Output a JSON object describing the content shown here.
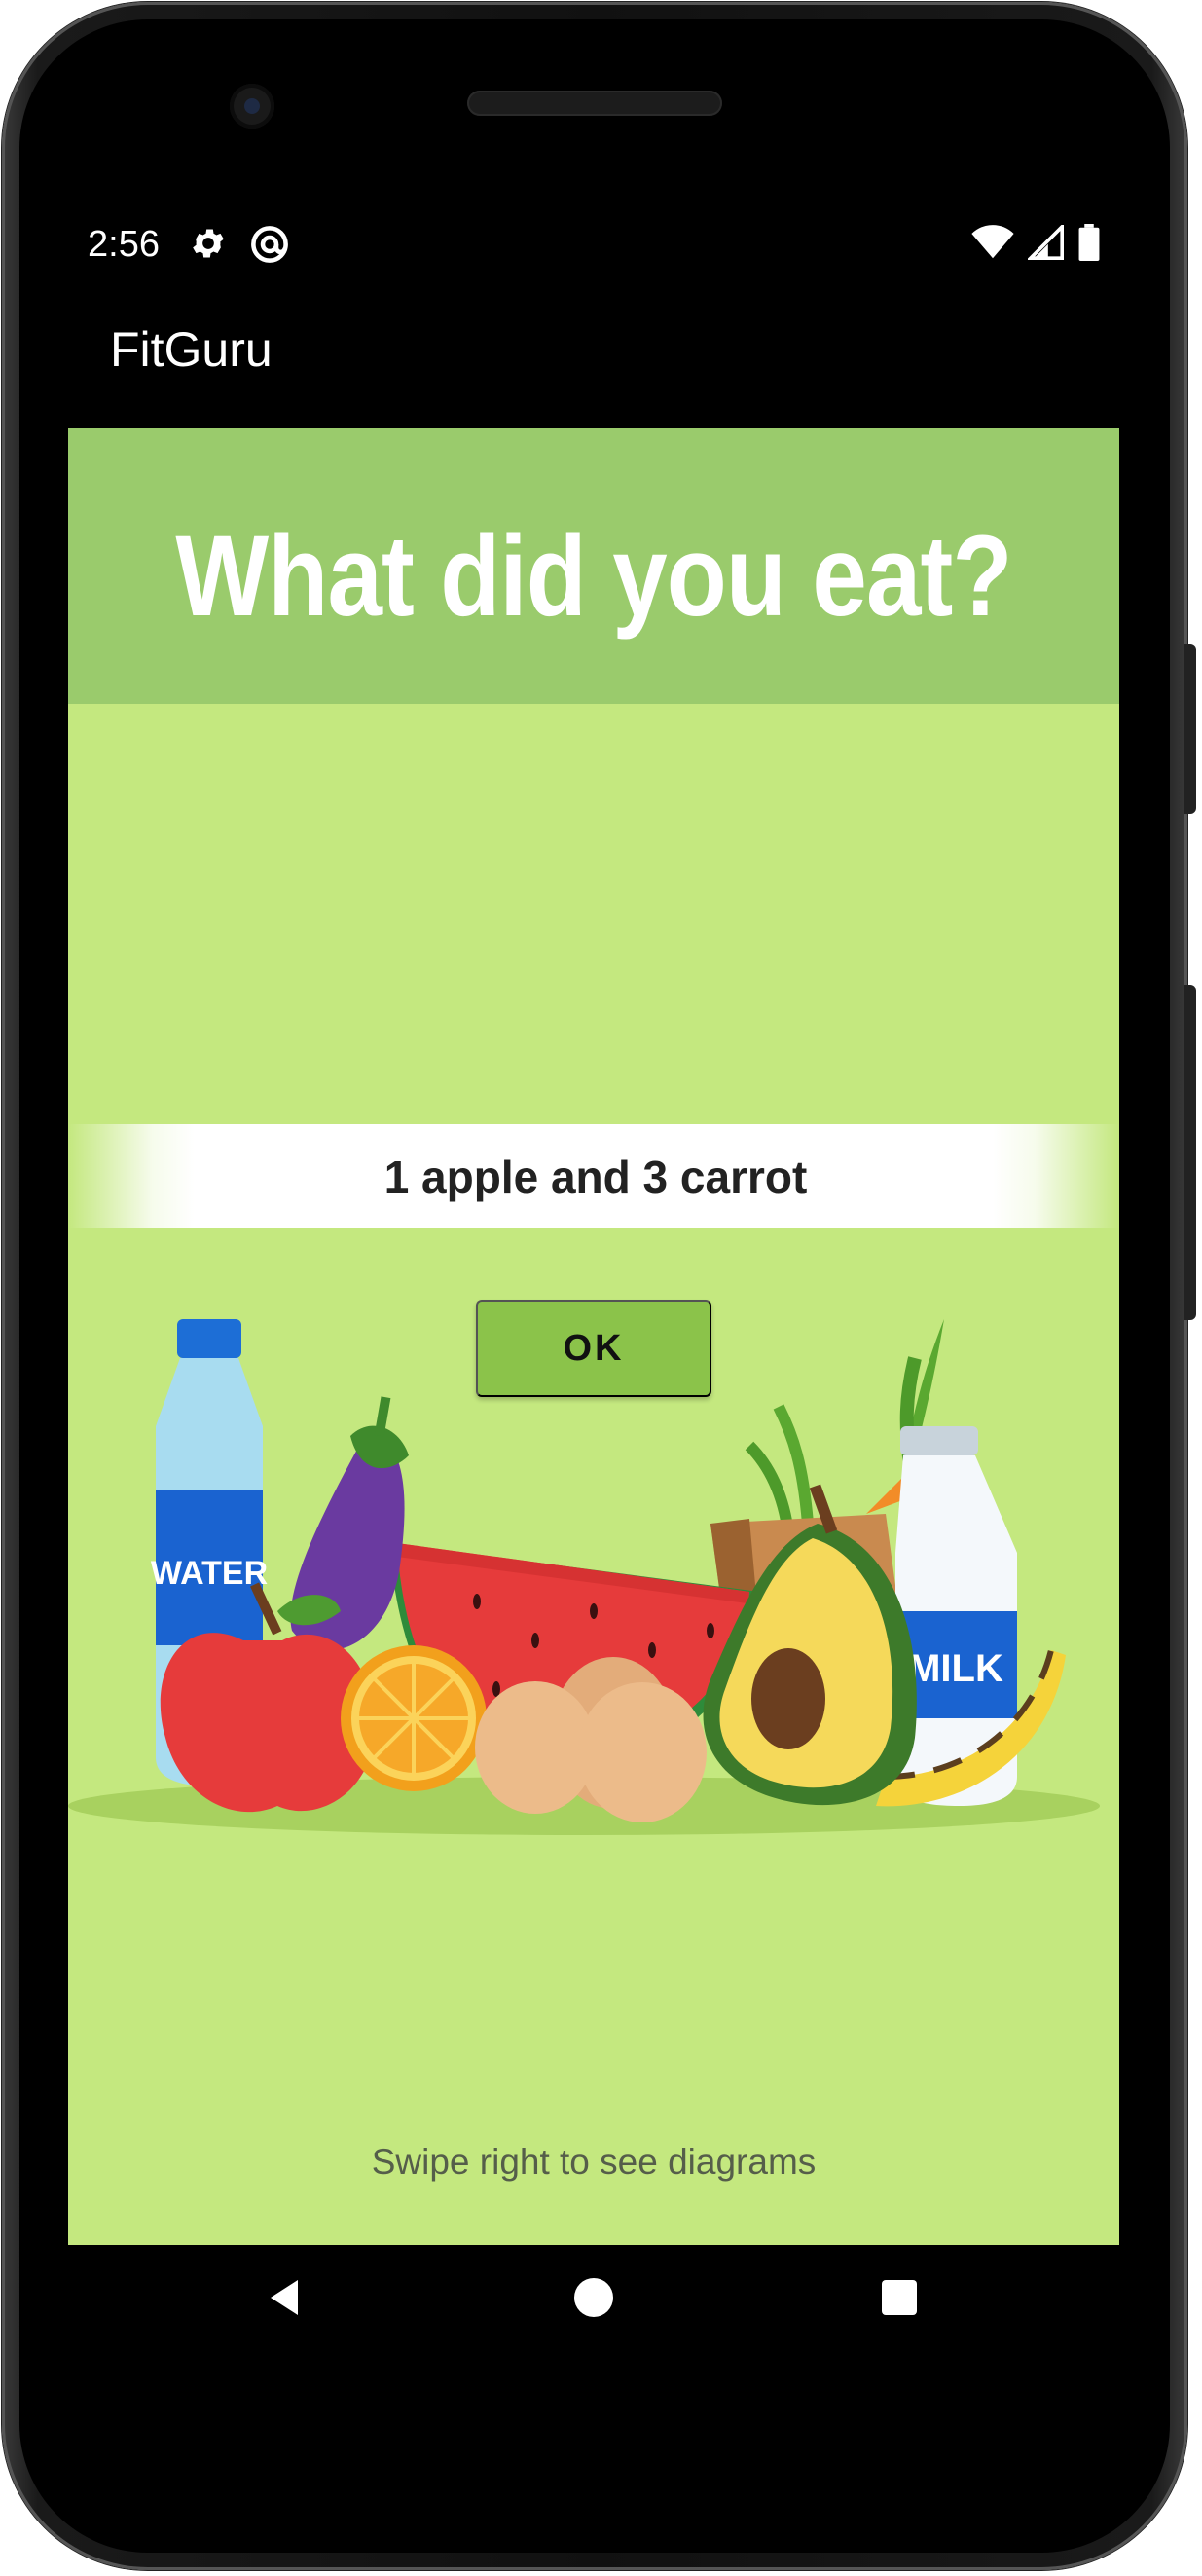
{
  "status_bar": {
    "time": "2:56",
    "left_icons": [
      "gear-icon",
      "at-sign-icon"
    ],
    "right_icons": [
      "wifi-icon",
      "signal-icon",
      "battery-icon"
    ]
  },
  "app_bar": {
    "title": "FitGuru"
  },
  "main": {
    "heading": "What did you eat?",
    "food_input": {
      "value": "1 apple and 3 carrot"
    },
    "ok_label": "OK",
    "illustration": {
      "water_label": "WATER",
      "milk_label": "MILK"
    },
    "hint": "Swipe right to see diagrams"
  },
  "nav_bar": {
    "buttons": [
      "back-icon",
      "home-icon",
      "recents-icon"
    ]
  },
  "colors": {
    "header_band": "#9acb6c",
    "background": "#c4e87f",
    "button": "#8bc34a"
  }
}
